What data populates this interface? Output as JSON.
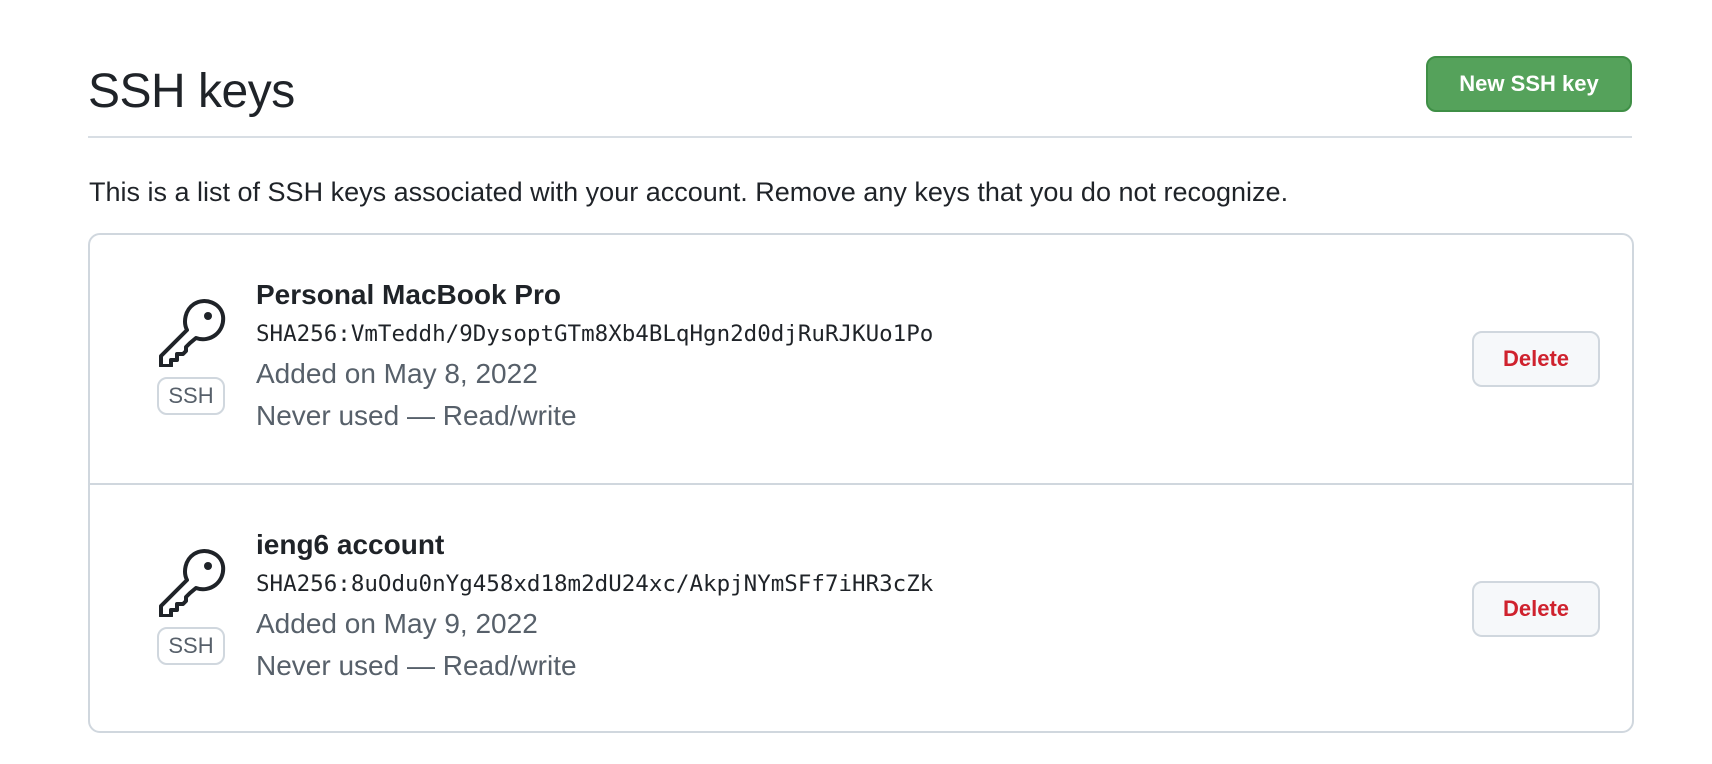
{
  "header": {
    "title": "SSH keys",
    "new_key_label": "New SSH key"
  },
  "intro": "This is a list of SSH keys associated with your account. Remove any keys that you do not recognize.",
  "keys": [
    {
      "name": "Personal MacBook Pro",
      "fingerprint": "SHA256:VmTeddh/9DysoptGTm8Xb4BLqHgn2d0djRuRJKUo1Po",
      "added": "Added on May 8, 2022",
      "usage": "Never used — Read/write",
      "badge": "SSH",
      "icon": "key-icon",
      "delete_label": "Delete"
    },
    {
      "name": "ieng6 account",
      "fingerprint": "SHA256:8uOdu0nYg458xd18m2dU24xc/AkpjNYmSFf7iHR3cZk",
      "added": "Added on May 9, 2022",
      "usage": "Never used — Read/write",
      "badge": "SSH",
      "icon": "key-icon",
      "delete_label": "Delete"
    }
  ],
  "colors": {
    "primary_button": "#55a25b",
    "danger_text": "#cf222e",
    "muted_text": "#57606a",
    "border": "#d0d7de"
  }
}
